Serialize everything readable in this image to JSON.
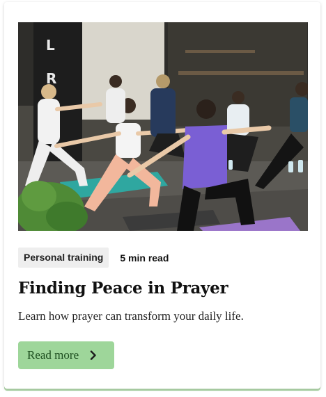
{
  "card": {
    "tag": "Personal training",
    "read_time": "5 min read",
    "title": "Finding Peace in Prayer",
    "description": "Learn how prayer can transform your daily life.",
    "button_label": "Read more",
    "button_icon": "chevron-right-icon",
    "image_semantic": "yoga-class-photo"
  },
  "colors": {
    "button_bg": "#9ed69a",
    "button_text": "#1c4d1e",
    "tag_bg": "#eeeeee",
    "card_accent_shadow": "#78be6e"
  }
}
